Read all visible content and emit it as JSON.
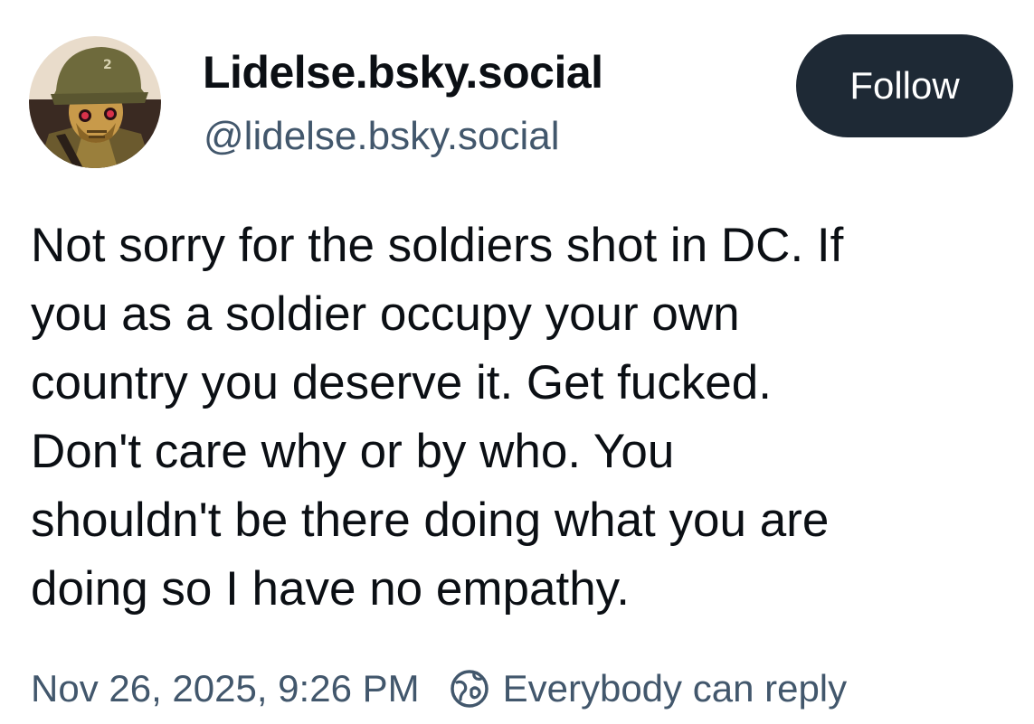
{
  "author": {
    "display_name": "Lidelse.bsky.social",
    "handle": "@lidelse.bsky.social",
    "avatar_icon": "helmeted-robot-avatar"
  },
  "follow_button": {
    "label": "Follow"
  },
  "post": {
    "lines": [
      "Not sorry for the soldiers shot in DC. If",
      "you as a soldier occupy your own",
      "country you deserve it. Get fucked.",
      "Don't care why or by who. You",
      "shouldn't be there doing what you are",
      "doing so I have no empathy."
    ]
  },
  "meta": {
    "timestamp": "Nov 26, 2025, 9:26 PM",
    "reply_setting": "Everybody can reply",
    "reply_icon": "globe-icon"
  },
  "colors": {
    "follow_bg": "#1e2935",
    "muted_text": "#42576c",
    "body_text": "#0b0f14"
  }
}
